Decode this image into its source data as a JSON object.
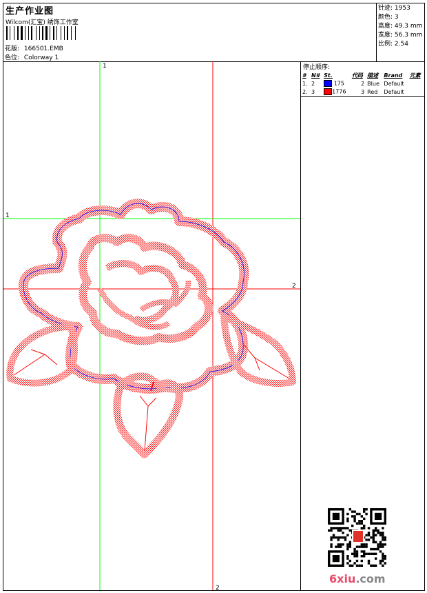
{
  "header": {
    "title": "生产作业图",
    "company": "Wilcom(汇宝) 绣饰工作室",
    "design_label": "花版:",
    "design_value": "166501.EMB",
    "colorway_label": "色位:",
    "colorway_value": "Colorway 1"
  },
  "stats": [
    {
      "label": "针迹:",
      "value": "1953"
    },
    {
      "label": "颜色:",
      "value": "3"
    },
    {
      "label": "高度:",
      "value": "49.3 mm"
    },
    {
      "label": "宽度:",
      "value": "56.3 mm"
    },
    {
      "label": "比例:",
      "value": "2.54"
    }
  ],
  "stop_sequence": {
    "title": "停止顺序:",
    "columns": [
      "#",
      "N#",
      "St.",
      "代码",
      "描述",
      "Brand",
      "元素"
    ],
    "rows": [
      {
        "idx": "1.",
        "n": "2",
        "color": "#0000ff",
        "st": "175",
        "code": "2",
        "desc": "Blue",
        "brand": "Default"
      },
      {
        "idx": "2.",
        "n": "3",
        "color": "#ff0000",
        "st": "1776",
        "code": "3",
        "desc": "Red",
        "brand": "Default"
      }
    ]
  },
  "guides": {
    "v1": "1",
    "v2": "2",
    "h1": "1",
    "h2": "2",
    "v2_bottom": "2"
  },
  "watermark": {
    "text": "6xiu",
    "suffix": ".com"
  },
  "colors": {
    "stitch": "#ff0000",
    "underlay": "#0000ff",
    "guide_green": "#00ff00",
    "guide_red": "#ff0000"
  }
}
